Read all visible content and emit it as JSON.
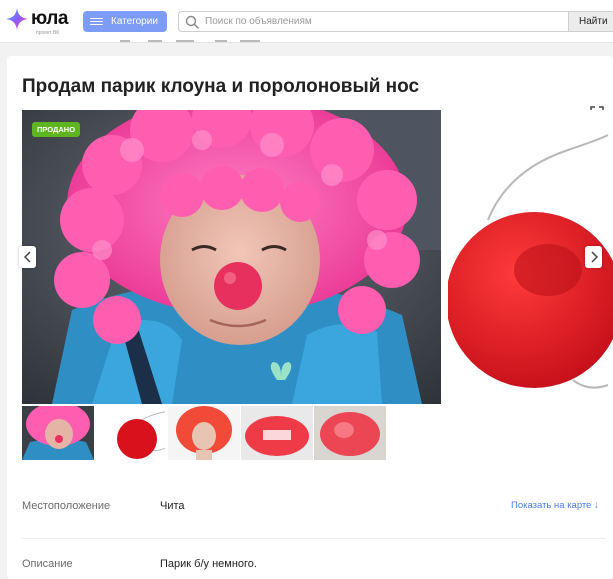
{
  "header": {
    "logo_text": "юла",
    "logo_sub": "проект ВК",
    "categories_label": "Категории",
    "search_placeholder": "Поиск по объявлениям",
    "find_label": "Найти"
  },
  "listing": {
    "title": "Продам парик клоуна и поролоновый нос",
    "status_badge": "ПРОДАНО",
    "photo_count": 5
  },
  "details": {
    "location_label": "Местоположение",
    "location_value": "Чита",
    "show_on_map": "Показать на карте ↓",
    "description_label": "Описание",
    "description_value": "Парик б/у немного."
  },
  "colors": {
    "accent": "#7c9cf5",
    "sold": "#5fb520",
    "link": "#4a7de6",
    "wig_pink": "#f0479e",
    "nose_red": "#e0141f"
  },
  "icons": {
    "logo": "star-logo-icon",
    "menu": "burger-icon",
    "search": "search-icon",
    "expand": "fullscreen-icon",
    "prev": "chevron-left-icon",
    "next": "chevron-right-icon"
  }
}
